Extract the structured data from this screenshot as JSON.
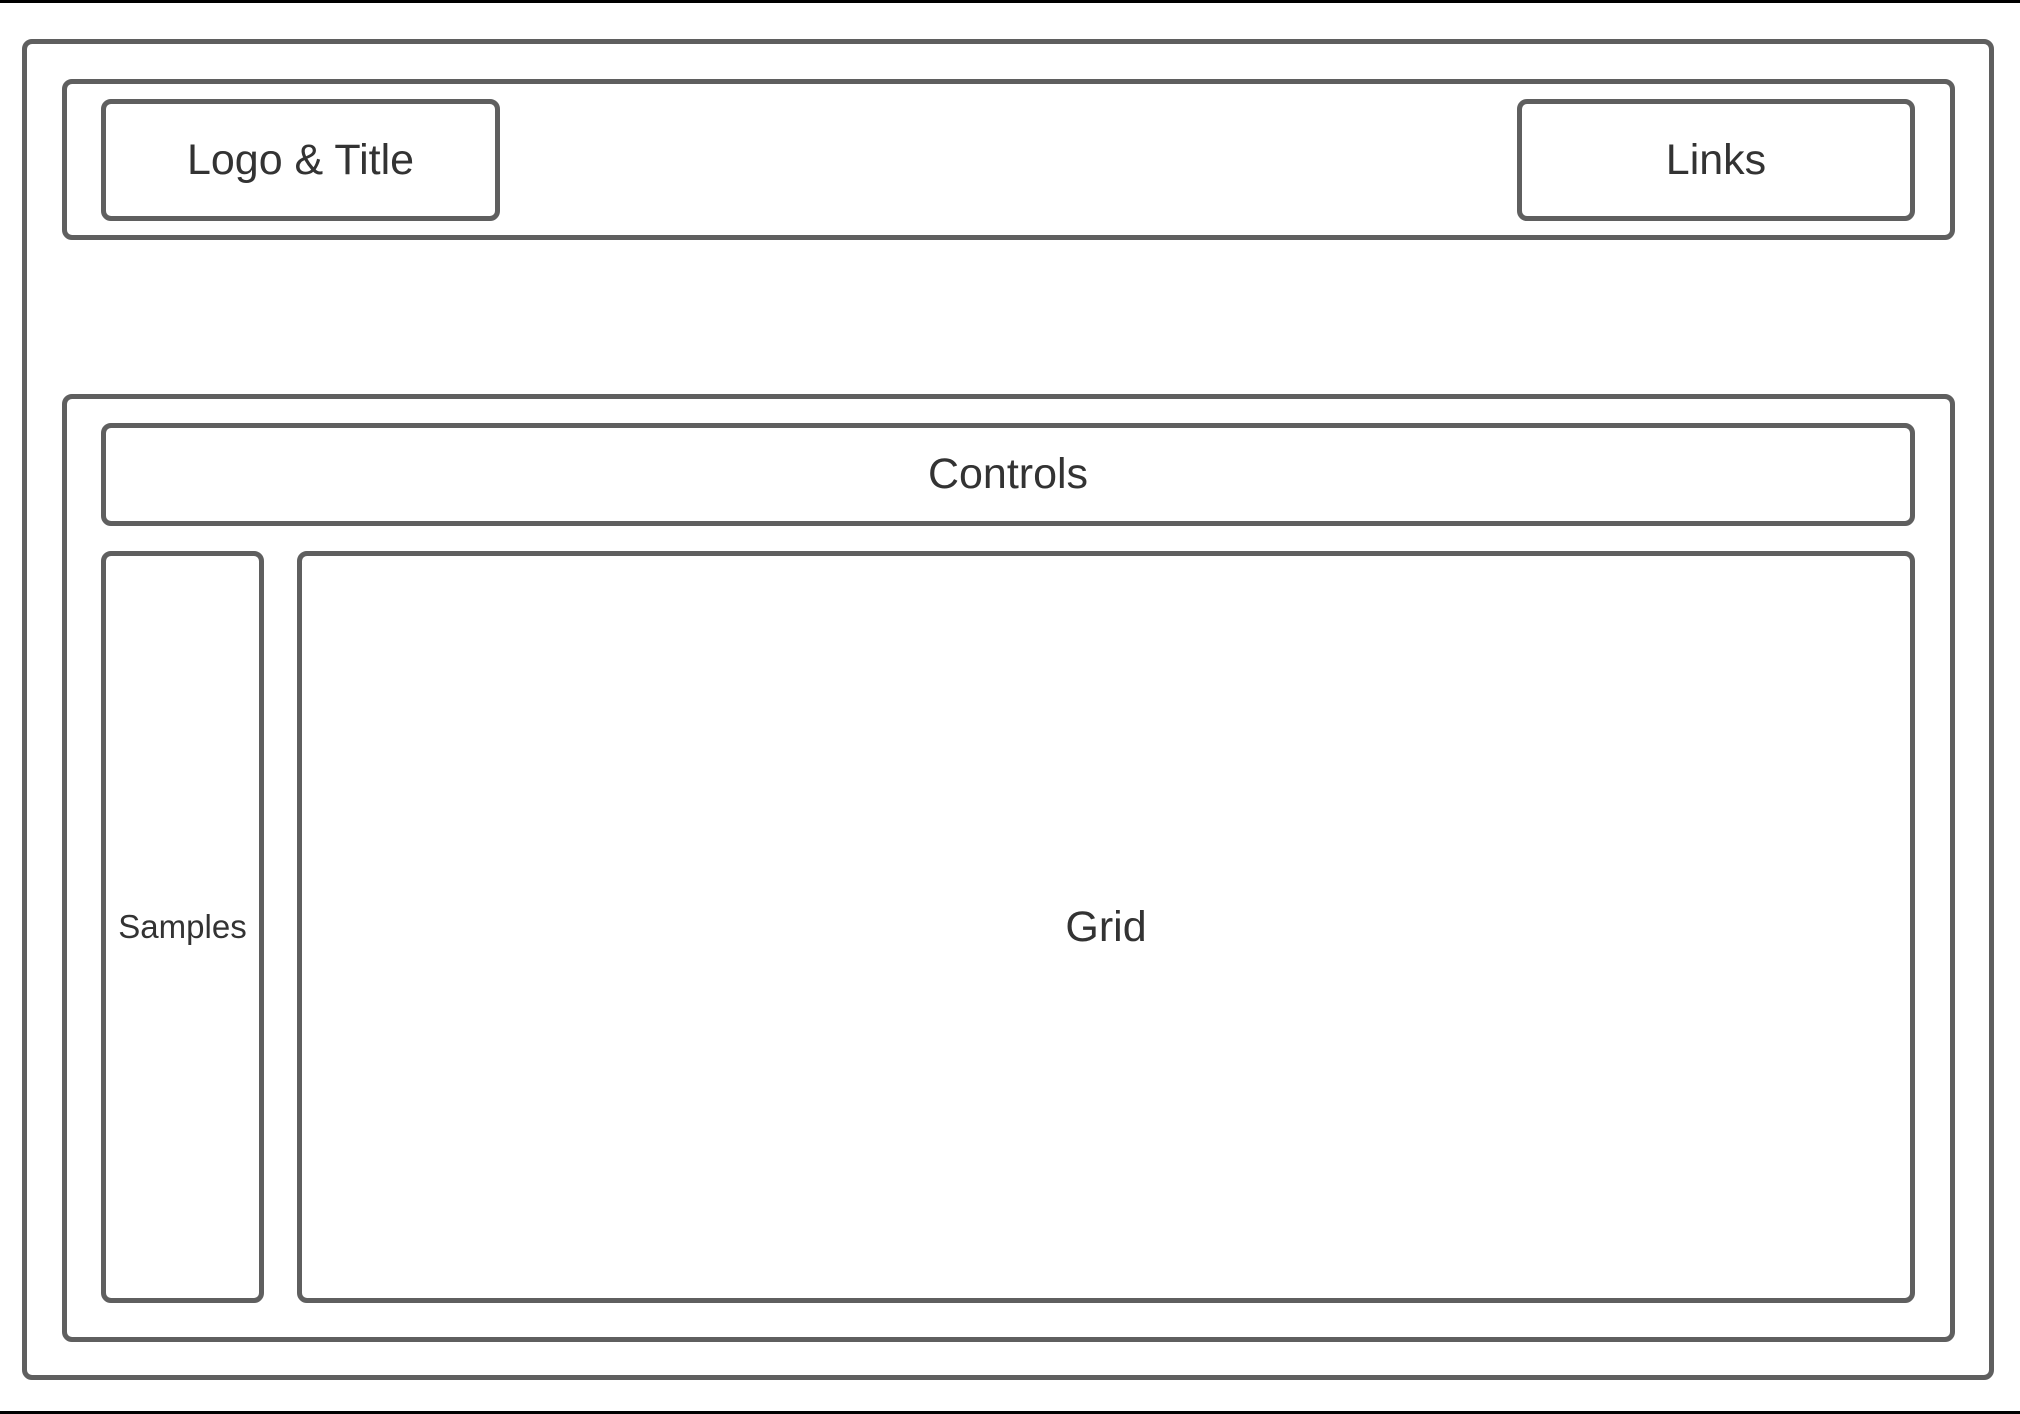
{
  "header": {
    "logo_title_label": "Logo & Title",
    "links_label": "Links"
  },
  "main": {
    "controls_label": "Controls",
    "samples_label": "Samples",
    "grid_label": "Grid"
  },
  "colors": {
    "stroke": "#5f5f5f",
    "text": "#333333"
  }
}
